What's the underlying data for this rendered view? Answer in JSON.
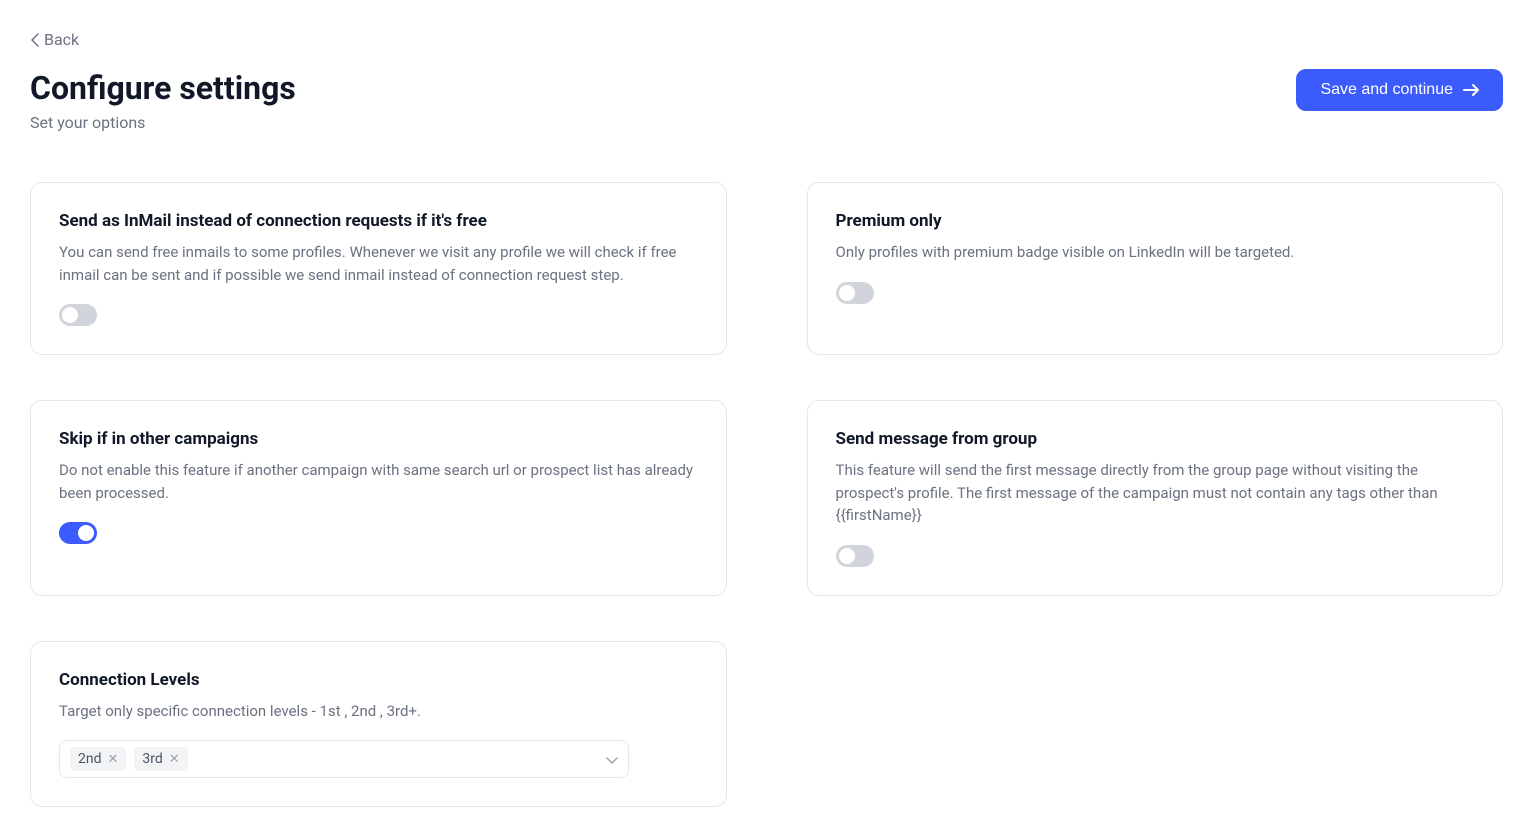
{
  "back": "Back",
  "title": "Configure settings",
  "subtitle": "Set your options",
  "saveButton": "Save and continue",
  "cards": {
    "inmail": {
      "title": "Send as InMail instead of connection requests if it's free",
      "description": "You can send free inmails to some profiles. Whenever we visit any profile we will check if free inmail can be sent and if possible we send inmail instead of connection request step.",
      "enabled": false
    },
    "premium": {
      "title": "Premium only",
      "description": "Only profiles with premium badge visible on LinkedIn will be targeted.",
      "enabled": false
    },
    "skipCampaign": {
      "title": "Skip if in other campaigns",
      "description": "Do not enable this feature if another campaign with same search url or prospect list has already been processed.",
      "enabled": true
    },
    "groupMessage": {
      "title": "Send message from group",
      "description": "This feature will send the first message directly from the group page without visiting the prospect's profile. The first message of the campaign must not contain any tags other than {{firstName}}",
      "enabled": false
    },
    "connectionLevels": {
      "title": "Connection Levels",
      "description": "Target only specific connection levels - 1st , 2nd , 3rd+.",
      "tags": [
        "2nd",
        "3rd"
      ]
    }
  }
}
